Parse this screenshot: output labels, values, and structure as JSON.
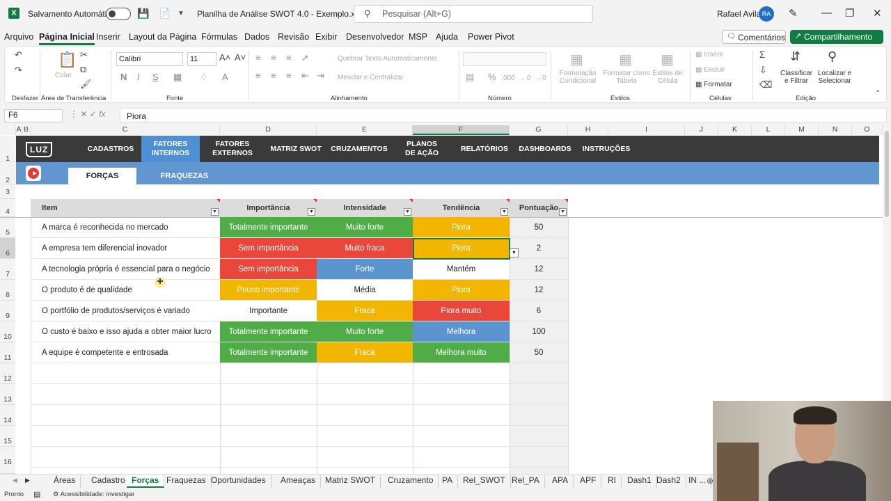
{
  "titlebar": {
    "autosave": "Salvamento Automático",
    "filename": "Planilha de Análise SWOT 4.0 - Exemplo.xlsx",
    "search_placeholder": "Pesquisar (Alt+G)",
    "user": "Rafael Avila",
    "avatar": "RA",
    "logo": "X"
  },
  "menu": [
    "Arquivo",
    "Página Inicial",
    "Inserir",
    "Layout da Página",
    "Fórmulas",
    "Dados",
    "Revisão",
    "Exibir",
    "Desenvolvedor",
    "MSP",
    "Ajuda",
    "Power Pivot"
  ],
  "comments": "Comentários",
  "share": "Compartilhamento",
  "ribbon": {
    "undo_label": "Desfazer",
    "clipboard_label": "Área de Transferência",
    "paste": "Colar",
    "font_label": "Fonte",
    "font_name": "Calibri",
    "font_size": "11",
    "align_label": "Alinhamento",
    "wrap": "Quebrar Texto Automaticamente",
    "merge": "Mesclar e Centralizar",
    "number_label": "Número",
    "styles_label": "Estilos",
    "cond_format": "Formatação\nCondicional",
    "format_table": "Formatar como\nTabela",
    "cell_styles": "Estilos de\nCélula",
    "cells_label": "Células",
    "insert": "Inserir",
    "delete": "Excluir",
    "format": "Formatar",
    "edit_label": "Edição",
    "sort": "Classificar\ne Filtrar",
    "find": "Localizar e\nSelecionar"
  },
  "formula": {
    "cell": "F6",
    "fx": "fx",
    "value": "Piora"
  },
  "columns": [
    "A",
    "B",
    "C",
    "D",
    "E",
    "F",
    "G",
    "H",
    "I",
    "J",
    "K",
    "L",
    "M",
    "N",
    "O"
  ],
  "rows": [
    "1",
    "2",
    "3",
    "4",
    "5",
    "6",
    "7",
    "8",
    "9",
    "10",
    "11",
    "12",
    "13",
    "14",
    "15",
    "16"
  ],
  "nav": {
    "logo": "LUZ",
    "items": [
      "CADASTROS",
      "FATORES\nINTERNOS",
      "FATORES\nEXTERNOS",
      "MATRIZ SWOT",
      "CRUZAMENTOS",
      "PLANOS\nDE AÇÃO",
      "RELATÓRIOS",
      "DASHBOARDS",
      "INSTRUÇÕES"
    ]
  },
  "subtabs": [
    "FORÇAS",
    "FRAQUEZAS"
  ],
  "table": {
    "headers": [
      "Item",
      "Importância",
      "Intensidade",
      "Tendência",
      "Pontuação"
    ],
    "rows": [
      {
        "item": "A marca é reconhecida no mercado",
        "imp": "Totalmente importante",
        "int": "Muito forte",
        "ten": "Piora",
        "pts": "50"
      },
      {
        "item": "A empresa tem diferencial inovador",
        "imp": "Sem importância",
        "int": "Muito fraca",
        "ten": "Piora",
        "pts": "2"
      },
      {
        "item": "A tecnologia própria é essencial para o negócio",
        "imp": "Sem importância",
        "int": "Forte",
        "ten": "Mantém",
        "pts": "12"
      },
      {
        "item": "O produto é de qualidade",
        "imp": "Pouco importante",
        "int": "Média",
        "ten": "Piora",
        "pts": "12"
      },
      {
        "item": "O portfólio de produtos/serviços é variado",
        "imp": "Importante",
        "int": "Fraca",
        "ten": "Piora muito",
        "pts": "6"
      },
      {
        "item": "O custo é baixo e isso ajuda a obter maior lucro",
        "imp": "Totalmente importante",
        "int": "Muito forte",
        "ten": "Melhora",
        "pts": "100"
      },
      {
        "item": "A equipe é competente e entrosada",
        "imp": "Totalmente importante",
        "int": "Fraca",
        "ten": "Melhora muito",
        "pts": "50"
      }
    ]
  },
  "colors": {
    "green": "#4fac47",
    "red": "#e9473a",
    "yellow": "#f2b600",
    "blue": "#5b95cf",
    "white": "#ffffff"
  },
  "sheet_tabs": [
    "Áreas",
    "Cadastro",
    "Forças",
    "Fraquezas",
    "Oportunidades",
    "Ameaças",
    "Matriz SWOT",
    "Cruzamento",
    "PA",
    "Rel_SWOT",
    "Rel_PA",
    "APA",
    "APF",
    "RI",
    "Dash1",
    "Dash2",
    "IN ..."
  ],
  "status": {
    "ready": "Pronto",
    "access": "Acessibilidade: investigar"
  }
}
